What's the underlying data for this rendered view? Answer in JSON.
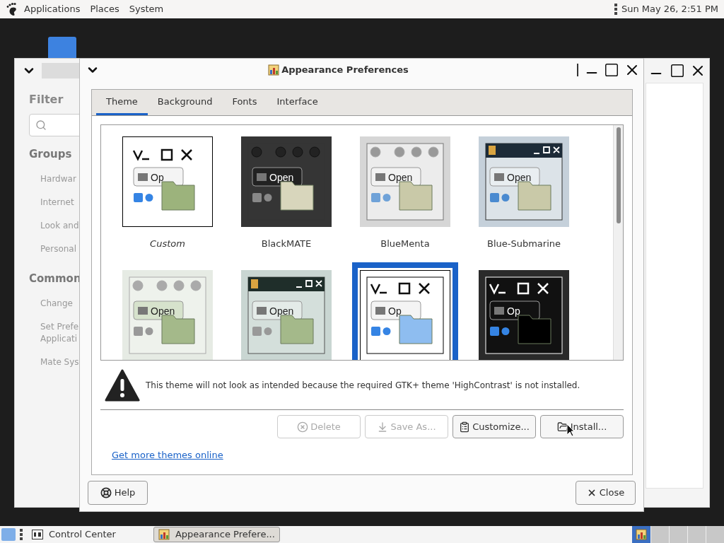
{
  "top_panel": {
    "menus": [
      "Applications",
      "Places",
      "System"
    ],
    "clock": "Sun May 26, 2:51 PM"
  },
  "background_window": {
    "filter_heading": "Filter",
    "sections": [
      {
        "heading": "Groups",
        "items": [
          {
            "lines": [
              "Hardwar"
            ]
          },
          {
            "lines": [
              "Internet"
            ]
          },
          {
            "lines": [
              "Look and"
            ]
          },
          {
            "lines": [
              "Personal"
            ]
          }
        ]
      },
      {
        "heading": "Common",
        "items": [
          {
            "lines": [
              "Change"
            ]
          },
          {
            "lines": [
              "Set Prefe",
              "Applicati"
            ]
          },
          {
            "lines": [
              "Mate Sys"
            ]
          }
        ]
      }
    ]
  },
  "dialog": {
    "title": "Appearance Preferences",
    "tabs": [
      {
        "label": "Theme",
        "selected": true
      },
      {
        "label": "Background",
        "selected": false
      },
      {
        "label": "Fonts",
        "selected": false
      },
      {
        "label": "Interface",
        "selected": false
      }
    ],
    "themes": [
      {
        "name": "Custom",
        "kind": "custom",
        "preview_label": "Op",
        "selected": false
      },
      {
        "name": "BlackMATE",
        "kind": "dark",
        "preview_label": "Open",
        "selected": false
      },
      {
        "name": "BlueMenta",
        "kind": "grey",
        "preview_label": "Open",
        "selected": false
      },
      {
        "name": "Blue-Submarine",
        "kind": "navy",
        "preview_label": "Open",
        "selected": false
      },
      {
        "kind": "pale",
        "preview_label": "Open",
        "selected": false
      },
      {
        "kind": "teal",
        "preview_label": "Open",
        "selected": false
      },
      {
        "kind": "contrast",
        "preview_label": "Op",
        "selected": true
      },
      {
        "kind": "inverse",
        "preview_label": "Op",
        "selected": false
      }
    ],
    "warning": "This theme will not look as intended because the required GTK+ theme 'HighContrast' is not installed.",
    "actions": [
      {
        "label": "Delete",
        "disabled": true
      },
      {
        "label": "Save As...",
        "disabled": true
      },
      {
        "label": "Customize...",
        "disabled": false
      },
      {
        "label": "Install...",
        "disabled": false
      }
    ],
    "link": "Get more themes online",
    "help_button": "Help",
    "close_button": "Close"
  },
  "taskbar": {
    "items": [
      {
        "label": "Control Center",
        "selected": false
      },
      {
        "label": "Appearance Prefere...",
        "selected": true
      }
    ]
  }
}
